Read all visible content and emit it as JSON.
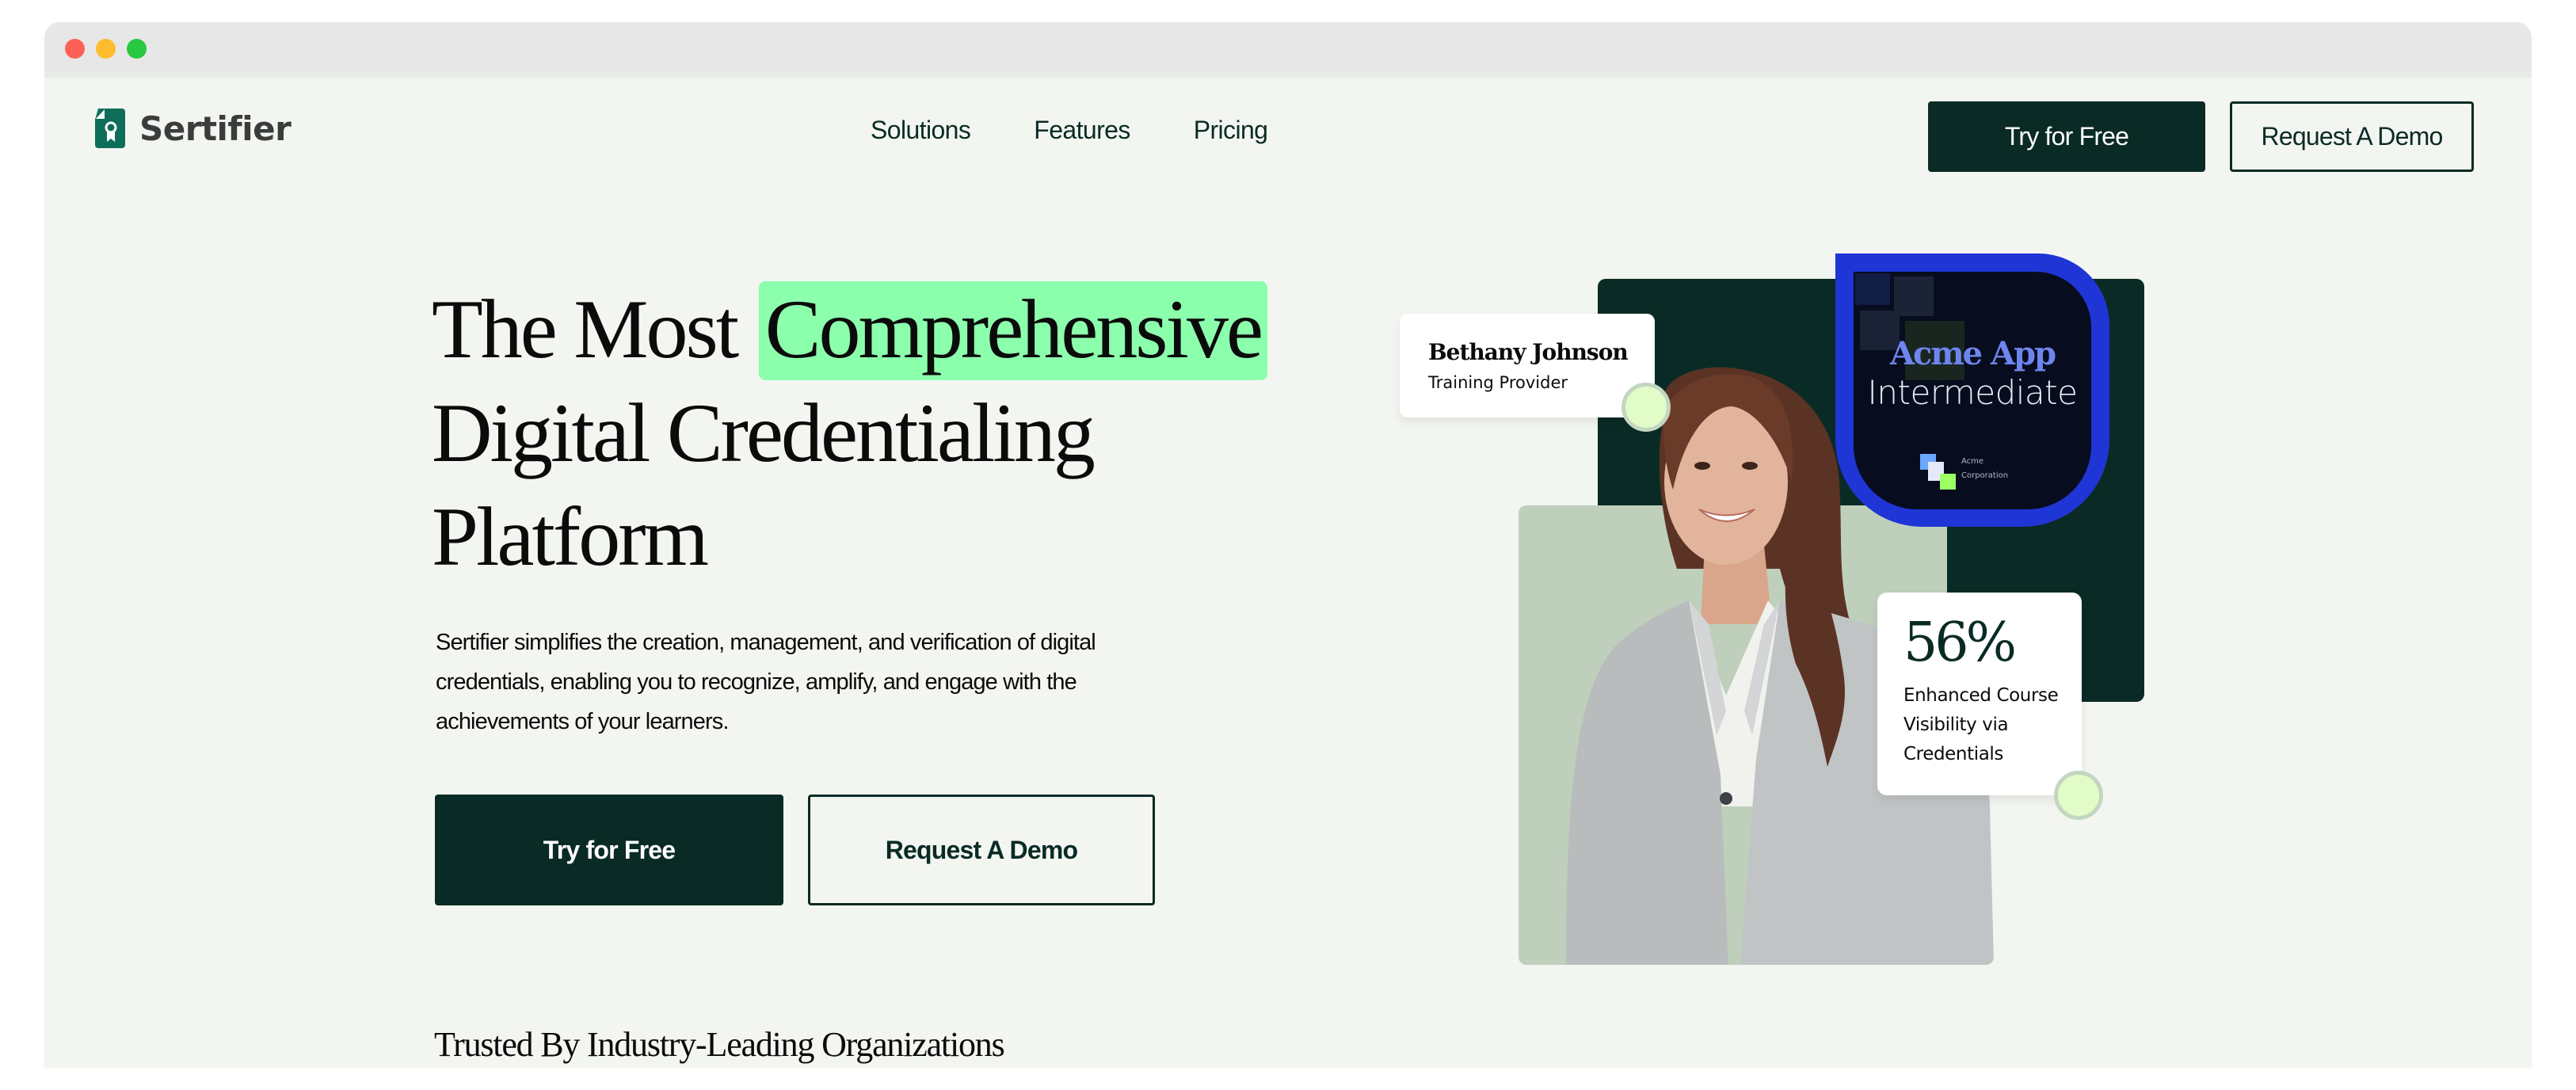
{
  "window": {
    "controls": [
      "close",
      "minimize",
      "maximize"
    ]
  },
  "header": {
    "brand": "Sertifier",
    "brand_icon": "certificate-ribbon-icon",
    "nav": [
      {
        "label": "Solutions"
      },
      {
        "label": "Features"
      },
      {
        "label": "Pricing"
      }
    ],
    "try_label": "Try for Free",
    "demo_label": "Request A Demo"
  },
  "hero": {
    "title_prefix": "The Most",
    "title_highlight": "Comprehensive",
    "title_line2": "Digital Credentialing",
    "title_line3": "Platform",
    "description": "Sertifier simplifies the creation, management, and verification of digital credentials, enabling you to recognize, amplify, and engage with the achievements of your learners.",
    "try_label": "Try for Free",
    "demo_label": "Request A Demo"
  },
  "visual": {
    "profile": {
      "name": "Bethany Johnson",
      "role": "Training Provider"
    },
    "badge": {
      "title": "Acme App",
      "level": "Intermediate",
      "org_line1": "Acme",
      "org_line2": "Corporation"
    },
    "stat": {
      "value": "56%",
      "label": "Enhanced Course Visibility via Credentials"
    },
    "photo_alt": "Smiling woman in a light grey blazer"
  },
  "trusted": {
    "heading": "Trusted By Industry-Leading Organizations"
  },
  "colors": {
    "brand_dark": "#0a2b25",
    "highlight": "#8cffad",
    "badge_blue": "#1f35d6",
    "accent_lime": "#e2fcc8",
    "sage": "#bed0bb",
    "logo_green": "#0e6e5a"
  }
}
